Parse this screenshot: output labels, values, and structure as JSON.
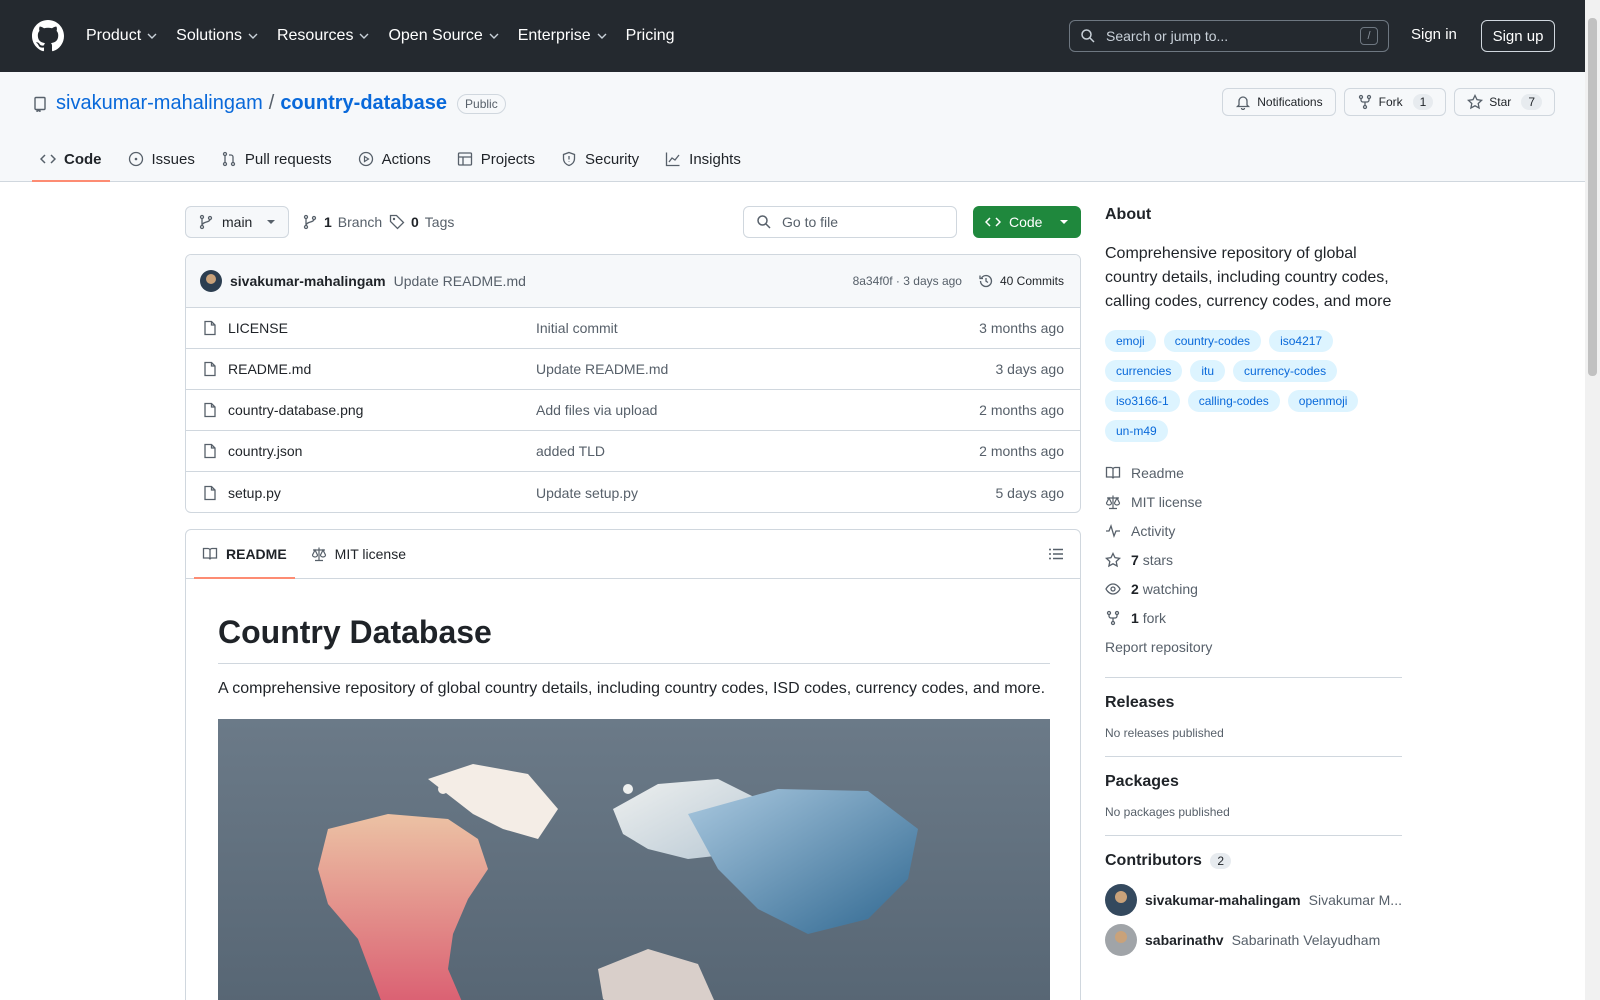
{
  "header": {
    "nav": [
      "Product",
      "Solutions",
      "Resources",
      "Open Source",
      "Enterprise",
      "Pricing"
    ],
    "search_placeholder": "Search or jump to...",
    "search_shortcut": "/",
    "signin": "Sign in",
    "signup": "Sign up"
  },
  "repo": {
    "owner": "sivakumar-mahalingam",
    "separator": "/",
    "name": "country-database",
    "visibility": "Public",
    "actions": {
      "notifications": "Notifications",
      "fork": "Fork",
      "fork_count": "1",
      "star": "Star",
      "star_count": "7"
    },
    "tabs": [
      "Code",
      "Issues",
      "Pull requests",
      "Actions",
      "Projects",
      "Security",
      "Insights"
    ]
  },
  "toolbar": {
    "branch": "main",
    "branch_count": "1",
    "branch_label": "Branch",
    "tag_count": "0",
    "tag_label": "Tags",
    "goto_placeholder": "Go to file",
    "code_label": "Code"
  },
  "latest_commit": {
    "author": "sivakumar-mahalingam",
    "message": "Update README.md",
    "sha_time": "8a34f0f · 3 days ago",
    "commits": "40 Commits"
  },
  "files": [
    {
      "name": "LICENSE",
      "message": "Initial commit",
      "age": "3 months ago"
    },
    {
      "name": "README.md",
      "message": "Update README.md",
      "age": "3 days ago"
    },
    {
      "name": "country-database.png",
      "message": "Add files via upload",
      "age": "2 months ago"
    },
    {
      "name": "country.json",
      "message": "added TLD",
      "age": "2 months ago"
    },
    {
      "name": "setup.py",
      "message": "Update setup.py",
      "age": "5 days ago"
    }
  ],
  "readme": {
    "tab_readme": "README",
    "tab_license": "MIT license",
    "title": "Country Database",
    "intro": "A comprehensive repository of global country details, including country codes, ISD codes, currency codes, and more."
  },
  "about": {
    "heading": "About",
    "description": "Comprehensive repository of global country details, including country codes, calling codes, currency codes, and more",
    "topics": [
      "emoji",
      "country-codes",
      "iso4217",
      "currencies",
      "itu",
      "currency-codes",
      "iso3166-1",
      "calling-codes",
      "openmoji",
      "un-m49"
    ],
    "links": {
      "readme": "Readme",
      "license": "MIT license",
      "activity": "Activity",
      "stars_count": "7",
      "stars_label": "stars",
      "watching_count": "2",
      "watching_label": "watching",
      "fork_count": "1",
      "fork_label": "fork",
      "report": "Report repository"
    }
  },
  "releases": {
    "heading": "Releases",
    "empty": "No releases published"
  },
  "packages": {
    "heading": "Packages",
    "empty": "No packages published"
  },
  "contributors": {
    "heading": "Contributors",
    "count": "2",
    "list": [
      {
        "login": "sivakumar-mahalingam",
        "name": "Sivakumar M..."
      },
      {
        "login": "sabarinathv",
        "name": "Sabarinath Velayudham"
      }
    ]
  }
}
